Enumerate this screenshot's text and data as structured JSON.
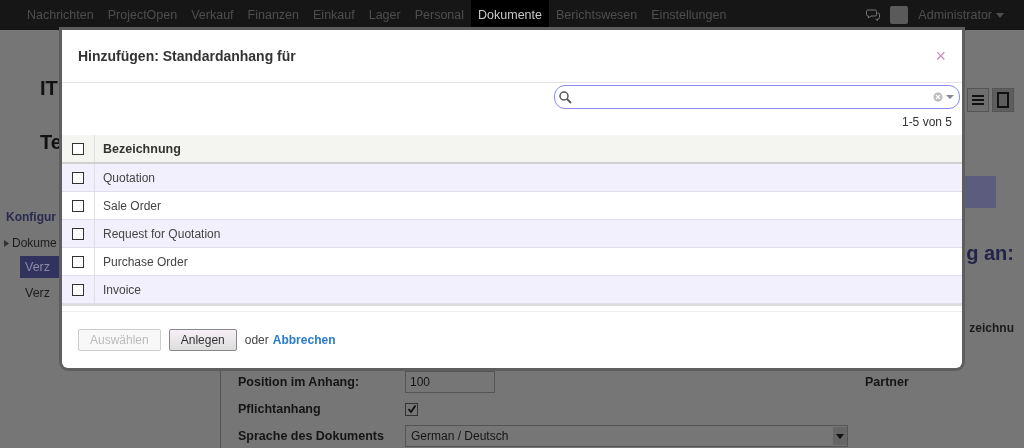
{
  "nav": {
    "items": [
      {
        "label": "Nachrichten",
        "selected": false
      },
      {
        "label": "ProjectOpen",
        "selected": false
      },
      {
        "label": "Verkauf",
        "selected": false
      },
      {
        "label": "Finanzen",
        "selected": false
      },
      {
        "label": "Einkauf",
        "selected": false
      },
      {
        "label": "Lager",
        "selected": false
      },
      {
        "label": "Personal",
        "selected": false
      },
      {
        "label": "Dokumente",
        "selected": true
      },
      {
        "label": "Berichtswesen",
        "selected": false
      },
      {
        "label": "Einstellungen",
        "selected": false
      }
    ],
    "user": "Administrator"
  },
  "sidebar": {
    "title_1": "IT",
    "title_2": "Te",
    "section": "Konfigur",
    "items": [
      {
        "label": "Dokume",
        "children": [
          {
            "label": "Verz",
            "selected": true
          },
          {
            "label": "Verz",
            "selected": false
          }
        ]
      }
    ]
  },
  "main": {
    "heading": "g an:",
    "column_label": "zeichnu",
    "partner_label": "Partner",
    "fields": [
      {
        "kind": "text",
        "label": "Position im Anhang:",
        "value": "100"
      },
      {
        "kind": "checkbox",
        "label": "Pflichtanhang",
        "checked": true
      },
      {
        "kind": "select",
        "label": "Sprache des Dokuments",
        "value": "German / Deutsch"
      }
    ]
  },
  "dialog": {
    "title": "Hinzufügen: Standardanhang für",
    "close": "×",
    "pager": "1-5 von 5",
    "column": "Bezeichnung",
    "all_checked": false,
    "rows": [
      {
        "name": "Quotation",
        "checked": false
      },
      {
        "name": "Sale Order",
        "checked": false
      },
      {
        "name": "Request for Quotation",
        "checked": false
      },
      {
        "name": "Purchase Order",
        "checked": false
      },
      {
        "name": "Invoice",
        "checked": false
      }
    ],
    "buttons": [
      {
        "label": "Auswählen",
        "disabled": true
      },
      {
        "label": "Anlegen",
        "disabled": false
      }
    ],
    "or": "oder",
    "cancel": "Abbrechen"
  }
}
